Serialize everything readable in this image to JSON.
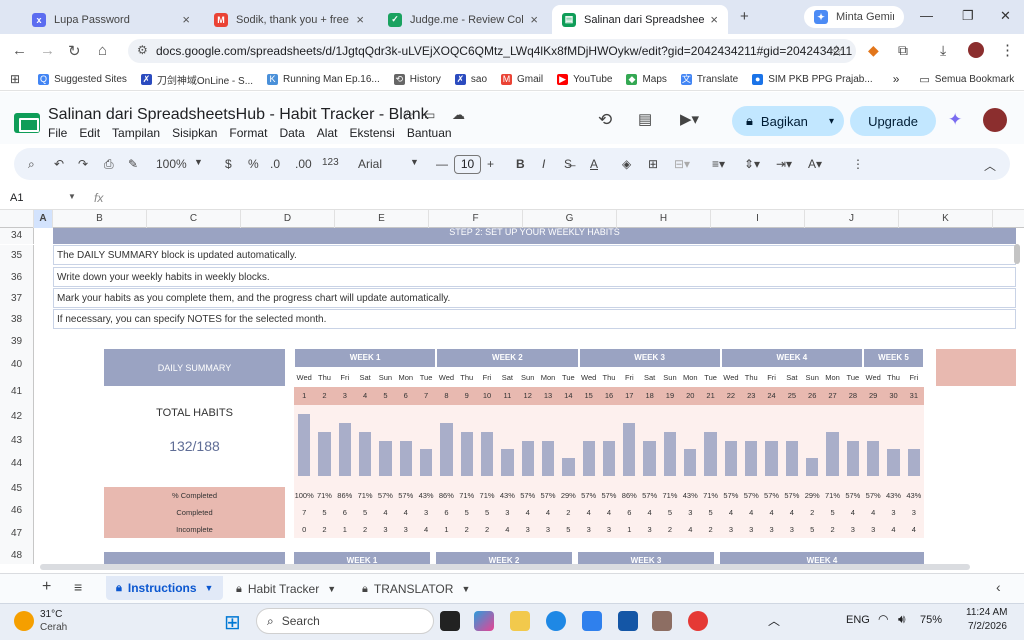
{
  "browser": {
    "tabs": [
      {
        "title": "Lupa Password",
        "color": "#5b6cf0",
        "icon": "x"
      },
      {
        "title": "Sodik, thank you + free tem",
        "color": "#ea4335",
        "icon": "M"
      },
      {
        "title": "Judge.me - Review Collectio",
        "color": "#1aa260",
        "icon": "✓"
      },
      {
        "title": "Salinan dari SpreadsheetsH",
        "color": "#0f9d58",
        "icon": "▤"
      },
      {
        "title": "Minta Gemini",
        "color": "#4c8bf5",
        "icon": "✦"
      }
    ],
    "new_tab": "+",
    "url": "docs.google.com/spreadsheets/d/1JgtqQdr3k-uLVEjXOQC6QMtz_LWq4lKx8fMDjHWOykw/edit?gid=2042434211#gid=2042434211",
    "bookmarks": [
      {
        "label": "Suggested Sites",
        "color": "#4285f4",
        "icon": "Q"
      },
      {
        "label": "刀剑神域OnLine - S...",
        "color": "#2b4bbf",
        "icon": "✗"
      },
      {
        "label": "Running Man Ep.16...",
        "color": "#4a90d9",
        "icon": "K"
      },
      {
        "label": "History",
        "color": "#666666",
        "icon": "⟲"
      },
      {
        "label": "sao",
        "color": "#2b4bbf",
        "icon": "✗"
      },
      {
        "label": "Gmail",
        "color": "#ea4335",
        "icon": "M"
      },
      {
        "label": "YouTube",
        "color": "#ff0000",
        "icon": "▶"
      },
      {
        "label": "Maps",
        "color": "#34a853",
        "icon": "◆"
      },
      {
        "label": "Translate",
        "color": "#4285f4",
        "icon": "文"
      },
      {
        "label": "SIM PKB PPG Prajab...",
        "color": "#1a73e8",
        "icon": "●"
      }
    ],
    "bookmarks_more": "»",
    "all_bookmarks": "Semua Bookmark"
  },
  "doc": {
    "title": "Salinan dari SpreadsheetsHub - Habit Tracker - Blank",
    "menus": [
      "File",
      "Edit",
      "Tampilan",
      "Sisipkan",
      "Format",
      "Data",
      "Alat",
      "Ekstensi",
      "Bantuan"
    ],
    "share_label": "Bagikan",
    "upgrade_label": "Upgrade"
  },
  "toolbar": {
    "zoom": "100%",
    "currency": "$",
    "percent": "%",
    "dec_dec": ".0",
    "dec_inc": ".00",
    "format_123": "123",
    "font": "Arial",
    "font_size": "10",
    "bold": "B",
    "italic": "I"
  },
  "formula": {
    "cell_ref": "A1",
    "fx": "fx"
  },
  "grid": {
    "columns": [
      "A",
      "B",
      "C",
      "D",
      "E",
      "F",
      "G",
      "H",
      "I",
      "J",
      "K"
    ],
    "rows": [
      "34",
      "35",
      "36",
      "37",
      "38",
      "39",
      "40",
      "41",
      "42",
      "43",
      "44",
      "45",
      "46",
      "47",
      "48"
    ],
    "step_heading": "STEP 2: SET UP YOUR WEEKLY HABITS",
    "instructions": [
      "The DAILY SUMMARY block is updated automatically.",
      "Write down your weekly habits in weekly blocks.",
      "Mark your habits as you complete them, and the progress chart will update automatically.",
      "If necessary, you can specify NOTES for the selected month."
    ],
    "daily_summary": "DAILY SUMMARY",
    "total_habits_label": "TOTAL HABITS",
    "total_habits_value": "132/188",
    "weeks": [
      "WEEK 1",
      "WEEK 2",
      "WEEK 3",
      "WEEK 4",
      "WEEK 5"
    ],
    "bottom_weeks": [
      "WEEK 1",
      "WEEK 2",
      "WEEK 3",
      "WEEK 4"
    ],
    "day_names": [
      "Wed",
      "Thu",
      "Fri",
      "Sat",
      "Sun",
      "Mon",
      "Tue",
      "Wed",
      "Thu",
      "Fri",
      "Sat",
      "Sun",
      "Mon",
      "Tue",
      "Wed",
      "Thu",
      "Fri",
      "Sat",
      "Sun",
      "Mon",
      "Tue",
      "Wed",
      "Thu",
      "Fri",
      "Sat",
      "Sun",
      "Mon",
      "Tue",
      "Wed",
      "Thu",
      "Fri"
    ],
    "day_numbers": [
      "1",
      "2",
      "3",
      "4",
      "5",
      "6",
      "7",
      "8",
      "9",
      "10",
      "11",
      "12",
      "13",
      "14",
      "15",
      "16",
      "17",
      "18",
      "19",
      "20",
      "21",
      "22",
      "23",
      "24",
      "25",
      "26",
      "27",
      "28",
      "29",
      "30",
      "31"
    ],
    "pct_label": "% Completed",
    "completed_label": "Completed",
    "incomplete_label": "Incomplete",
    "pct_completed": [
      "100%",
      "71%",
      "86%",
      "71%",
      "57%",
      "57%",
      "43%",
      "86%",
      "71%",
      "71%",
      "43%",
      "57%",
      "57%",
      "29%",
      "57%",
      "57%",
      "86%",
      "57%",
      "71%",
      "43%",
      "71%",
      "57%",
      "57%",
      "57%",
      "57%",
      "29%",
      "71%",
      "57%",
      "57%",
      "43%",
      "43%"
    ],
    "completed": [
      "7",
      "5",
      "6",
      "5",
      "4",
      "4",
      "3",
      "6",
      "5",
      "5",
      "3",
      "4",
      "4",
      "2",
      "4",
      "4",
      "6",
      "4",
      "5",
      "3",
      "5",
      "4",
      "4",
      "4",
      "4",
      "2",
      "5",
      "4",
      "4",
      "3",
      "3"
    ],
    "incomplete": [
      "0",
      "2",
      "1",
      "2",
      "3",
      "3",
      "4",
      "1",
      "2",
      "2",
      "4",
      "3",
      "3",
      "5",
      "3",
      "3",
      "1",
      "3",
      "2",
      "4",
      "2",
      "3",
      "3",
      "3",
      "3",
      "5",
      "2",
      "3",
      "3",
      "4",
      "4"
    ]
  },
  "chart_data": {
    "type": "bar",
    "categories": [
      "1",
      "2",
      "3",
      "4",
      "5",
      "6",
      "7",
      "8",
      "9",
      "10",
      "11",
      "12",
      "13",
      "14",
      "15",
      "16",
      "17",
      "18",
      "19",
      "20",
      "21",
      "22",
      "23",
      "24",
      "25",
      "26",
      "27",
      "28",
      "29",
      "30",
      "31"
    ],
    "values": [
      100,
      71,
      86,
      71,
      57,
      57,
      43,
      86,
      71,
      71,
      43,
      57,
      57,
      29,
      57,
      57,
      86,
      57,
      71,
      43,
      71,
      57,
      57,
      57,
      57,
      29,
      71,
      57,
      57,
      43,
      43
    ],
    "ylim": [
      0,
      100
    ],
    "color": "#a9aec9"
  },
  "sheets": [
    {
      "label": "Instructions",
      "active": true
    },
    {
      "label": "Habit Tracker",
      "active": false
    },
    {
      "label": "TRANSLATOR",
      "active": false
    }
  ],
  "taskbar": {
    "temp": "31°C",
    "weather": "Cerah",
    "search": "Search",
    "lang": "ENG",
    "battery": "75%",
    "time": "11:24 AM",
    "date": "7/2/2026"
  }
}
